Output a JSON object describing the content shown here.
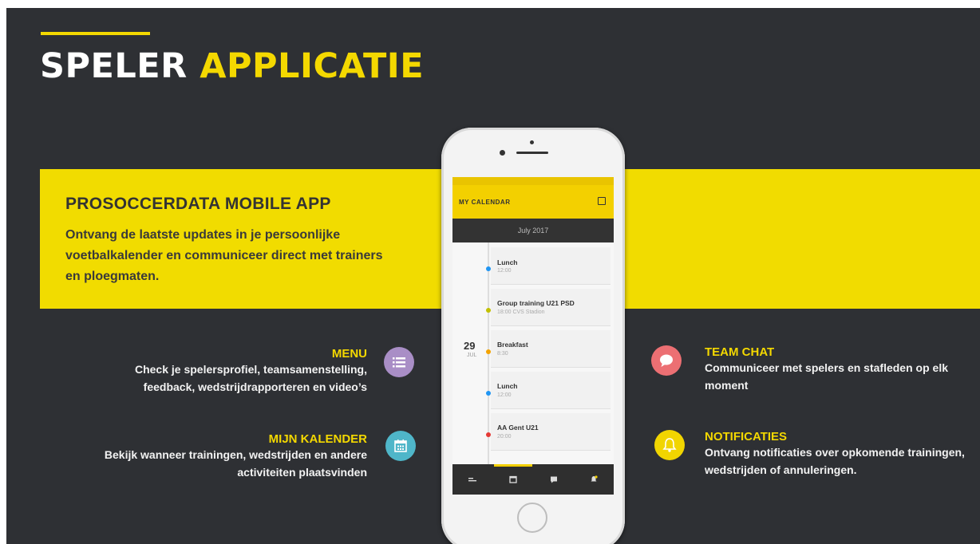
{
  "title": {
    "white": "SPELER",
    "yellow": "APPLICATIE"
  },
  "band": {
    "title": "PROSOCCERDATA  MOBILE APP",
    "text": "Ontvang de laatste updates in je persoonlijke voetbalkalender en communiceer direct met trainers en ploegmaten."
  },
  "features": {
    "menu": {
      "title": "MENU",
      "text": "Check je spelersprofiel,  teamsamenstelling, feedback, wedstrijdrapporteren  en video’s",
      "icon": "list-icon",
      "color": "#a98ec6"
    },
    "kalender": {
      "title": "MIJN KALENDER",
      "text": "Bekijk wanneer trainingen, wedstrijden en andere activiteiten plaatsvinden",
      "icon": "calendar-icon",
      "color": "#4fb6c9"
    },
    "chat": {
      "title": "TEAM CHAT",
      "text": "Communiceer met spelers en stafleden op elk moment",
      "icon": "chat-bubble-icon",
      "color": "#ec6f73"
    },
    "notificaties": {
      "title": "NOTIFICATIES",
      "text": "Ontvang notificaties  over opkomende trainingen, wedstrijden  of annuleringen.",
      "icon": "bell-icon",
      "color": "#f1d500"
    }
  },
  "phone": {
    "appbar_title": "MY CALENDAR",
    "month": "July 2017",
    "day": "29",
    "day_month": "JUL",
    "events": [
      {
        "name": "Lunch",
        "time": "12:00",
        "color": "#2196f3"
      },
      {
        "name": "Group training U21 PSD",
        "time": "18:00   CVS Stadion",
        "color": "#c2c000"
      },
      {
        "name": "Breakfast",
        "time": "8:30",
        "color": "#f4a300"
      },
      {
        "name": "Lunch",
        "time": "12:00",
        "color": "#2196f3"
      },
      {
        "name": "AA Gent U21",
        "time": "20:00",
        "color": "#e53935"
      }
    ],
    "tabs": [
      "menu-icon",
      "calendar-icon",
      "chat-icon",
      "notification-icon"
    ]
  }
}
